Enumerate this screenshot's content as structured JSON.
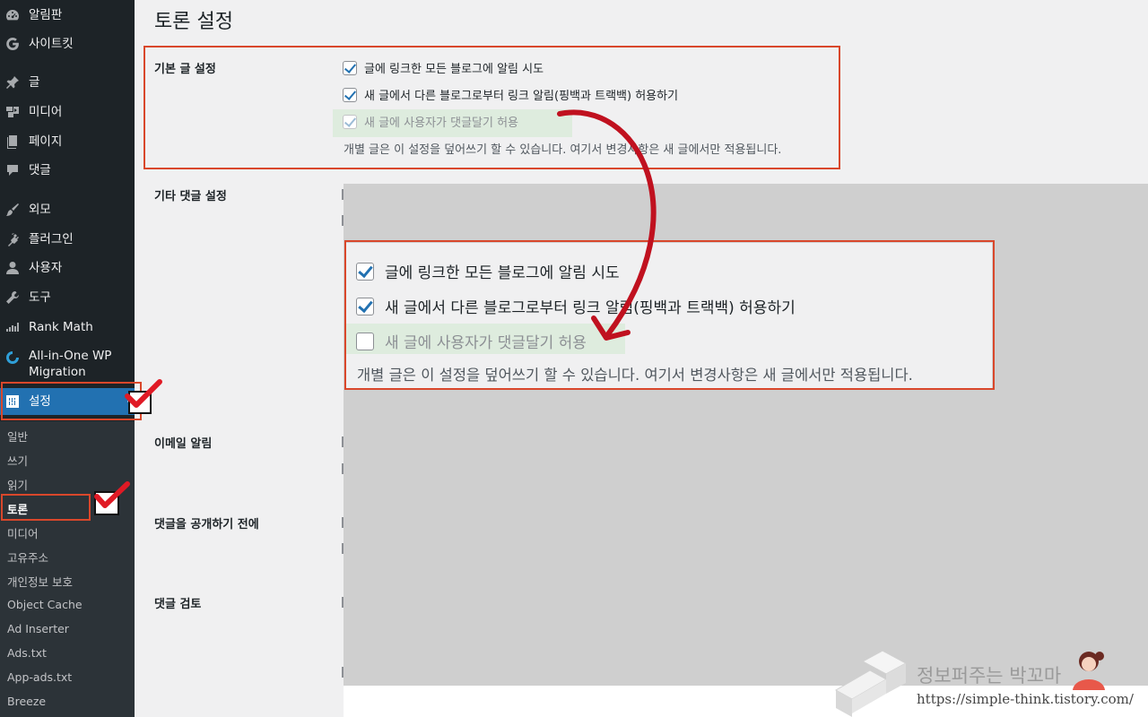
{
  "sidebar": {
    "items": [
      {
        "label": "알림판",
        "icon": "dashboard-icon"
      },
      {
        "label": "사이트킷",
        "icon": "google-g-icon"
      },
      {
        "label": "글",
        "icon": "pin-icon"
      },
      {
        "label": "미디어",
        "icon": "media-icon"
      },
      {
        "label": "페이지",
        "icon": "page-icon"
      },
      {
        "label": "댓글",
        "icon": "comment-icon"
      },
      {
        "label": "외모",
        "icon": "brush-icon"
      },
      {
        "label": "플러그인",
        "icon": "plugin-icon"
      },
      {
        "label": "사용자",
        "icon": "user-icon"
      },
      {
        "label": "도구",
        "icon": "wrench-icon"
      },
      {
        "label": "Rank Math",
        "icon": "rank-math-icon"
      },
      {
        "label": "All-in-One WP Migration",
        "icon": "migration-icon"
      },
      {
        "label": "설정",
        "icon": "settings-icon"
      }
    ],
    "submenu": [
      "일반",
      "쓰기",
      "읽기",
      "토론",
      "미디어",
      "고유주소",
      "개인정보 보호",
      "Object Cache",
      "Ad Inserter",
      "Ads.txt",
      "App-ads.txt",
      "Breeze"
    ],
    "active_item": "설정",
    "current_sub": "토론"
  },
  "page": {
    "title": "토론 설정",
    "sections": {
      "default_post": "기본 글 설정",
      "other_comment": "기타 댓글 설정",
      "email": "이메일 알림",
      "before_publish": "댓글을 공개하기 전에",
      "moderation": "댓글 검토"
    },
    "options": [
      {
        "label": "글에 링크한 모든 블로그에 알림 시도",
        "checked": true
      },
      {
        "label": "새 글에서 다른 블로그로부터 링크 알림(핑백과 트랙백) 허용하기",
        "checked": true
      },
      {
        "label": "새 글에 사용자가 댓글달기 허용",
        "checked": true
      }
    ],
    "description": "개별 글은 이 설정을 덮어쓰기 할 수 있습니다. 여기서 변경사항은 새 글에서만 적용됩니다."
  },
  "zoom": {
    "options": [
      {
        "label": "글에 링크한 모든 블로그에 알림 시도",
        "checked": true
      },
      {
        "label": "새 글에서 다른 블로그로부터 링크 알림(핑백과 트랙백) 허용하기",
        "checked": true
      },
      {
        "label": "새 글에 사용자가 댓글달기 허용",
        "checked": false
      }
    ],
    "description": "개별 글은 이 설정을 덮어쓰기 할 수 있습니다. 여기서 변경사항은 새 글에서만 적용됩니다."
  },
  "watermark": {
    "name": "정보퍼주는 박꼬마",
    "url": "https://simple-think.tistory.com/"
  },
  "colors": {
    "sidebar": "#1d2327",
    "active": "#2271b1",
    "annotation": "#d9472b",
    "arrow": "#c0111f"
  }
}
